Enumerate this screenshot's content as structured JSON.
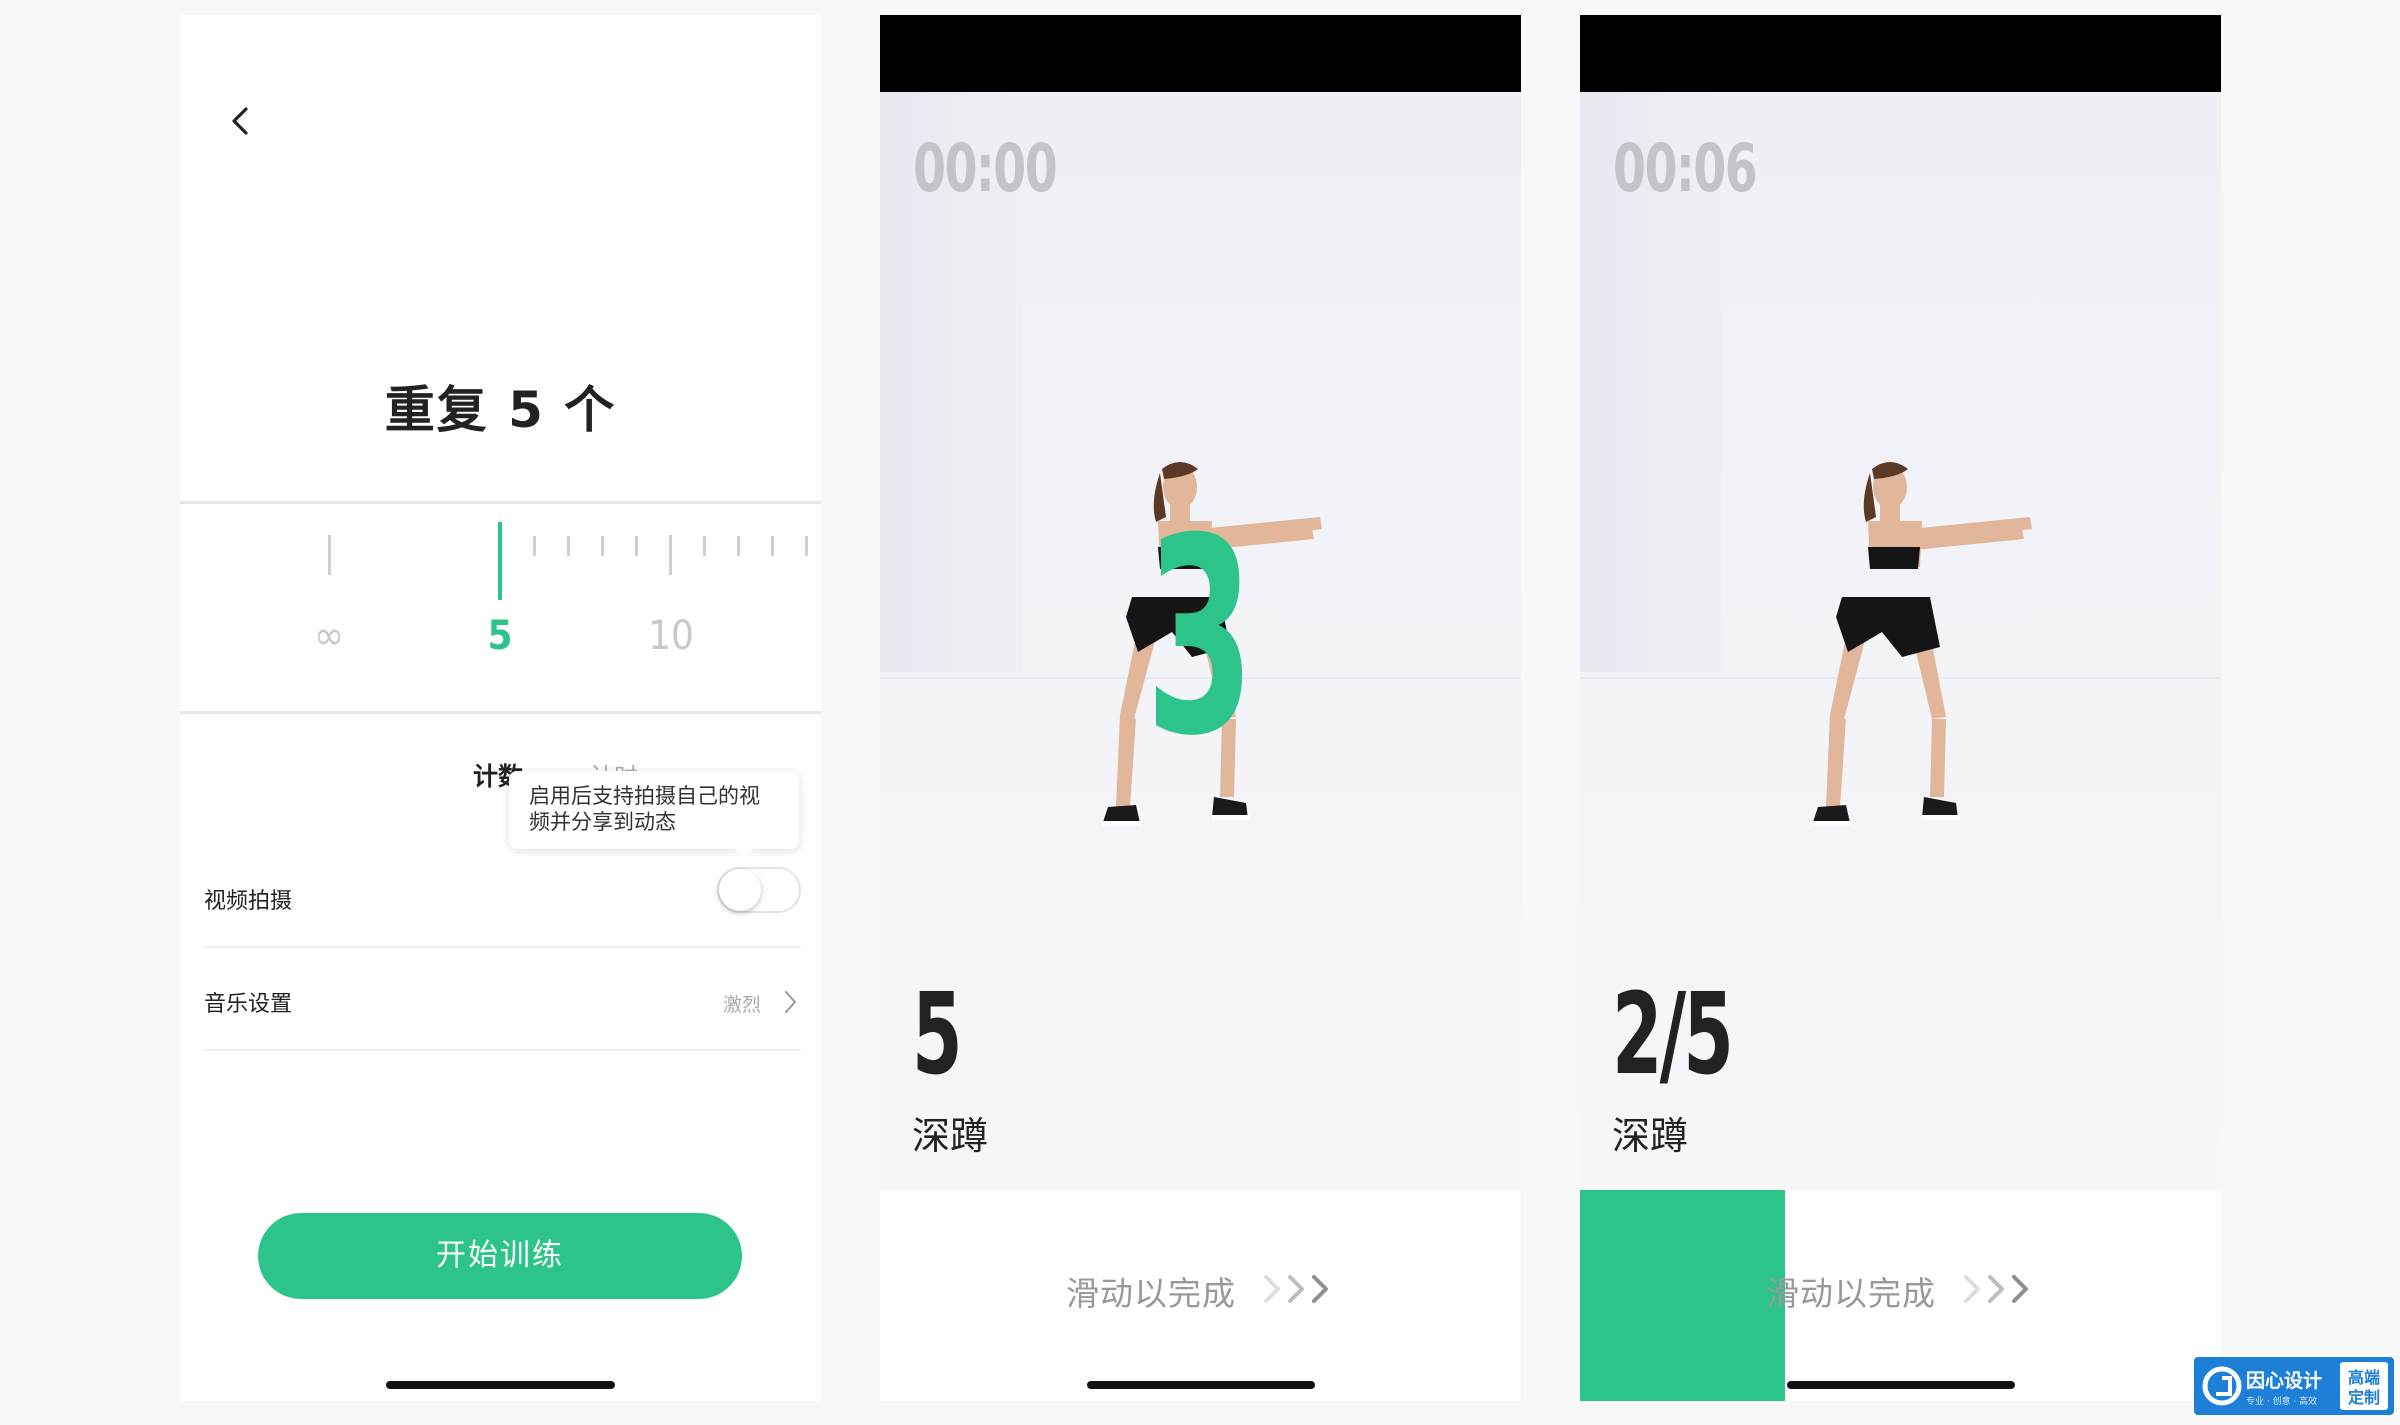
{
  "setup_screen": {
    "title": "重复 5 个",
    "ruler": {
      "labels": [
        "∞",
        "5",
        "10"
      ],
      "selected": "5"
    },
    "mode_tabs": [
      {
        "label": "计数",
        "selected": true
      },
      {
        "label": "计时",
        "selected": false
      }
    ],
    "tooltip": {
      "line1": "启用后支持拍摄自己的视",
      "line2": "频并分享到动态"
    },
    "video_row": {
      "label": "视频拍摄",
      "enabled": false
    },
    "music_row": {
      "label": "音乐设置",
      "value": "激烈"
    },
    "start_button": "开始训练"
  },
  "screen_countdown": {
    "timer": "00:00",
    "countdown_number": "3",
    "rep_count": "5",
    "exercise": "深蹲",
    "swipe_label": "滑动以完成"
  },
  "screen_progress": {
    "timer": "00:06",
    "rep_count": "2/5",
    "exercise": "深蹲",
    "swipe_label": "滑动以完成",
    "swipe_progress": 0.32
  },
  "colors": {
    "accent": "#2dc48b",
    "text": "#222222",
    "muted": "#999999",
    "watermark": "#1d7fd8"
  },
  "watermark": {
    "main": "因心设计",
    "sub": "专业 · 创意 · 高效",
    "badge_top": "高端",
    "badge_bottom": "定制"
  }
}
